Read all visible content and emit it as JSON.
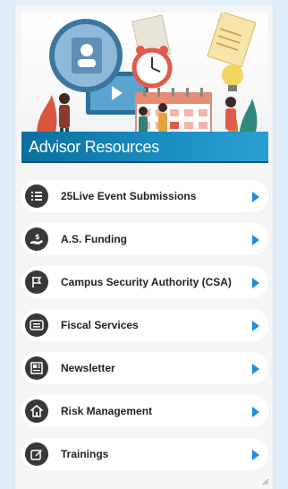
{
  "banner": {
    "title": "Advisor Resources"
  },
  "colors": {
    "page_bg": "#deeefb",
    "banner_bar": "#1b8fc2",
    "arrow": "#1a8fe0",
    "icon_bg": "#383838"
  },
  "items": [
    {
      "label": "25Live Event Submissions",
      "icon": "list-icon"
    },
    {
      "label": "A.S. Funding",
      "icon": "money-hand-icon"
    },
    {
      "label": "Campus Security Authority (CSA)",
      "icon": "flag-icon"
    },
    {
      "label": "Fiscal Services",
      "icon": "id-card-icon"
    },
    {
      "label": "Newsletter",
      "icon": "newspaper-icon"
    },
    {
      "label": "Risk Management",
      "icon": "shield-home-icon"
    },
    {
      "label": "Trainings",
      "icon": "edit-icon"
    }
  ]
}
